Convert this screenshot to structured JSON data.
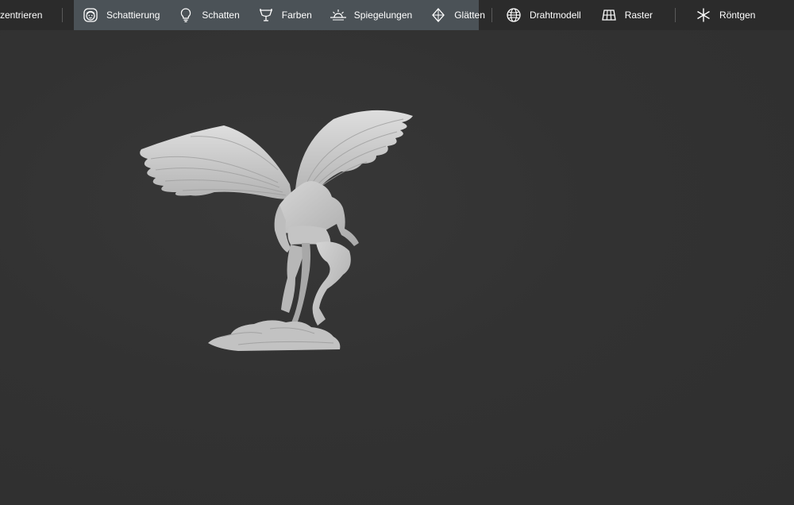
{
  "toolbar": {
    "center_label": "zentrieren",
    "render_group": [
      {
        "id": "shading",
        "label": "Schattierung",
        "icon": "shading-face-icon"
      },
      {
        "id": "shadows",
        "label": "Schatten",
        "icon": "lightbulb-icon"
      },
      {
        "id": "colors",
        "label": "Farben",
        "icon": "paint-bucket-icon"
      },
      {
        "id": "reflections",
        "label": "Spiegelungen",
        "icon": "sunrise-icon"
      },
      {
        "id": "smooth",
        "label": "Glätten",
        "icon": "diamond-icon"
      }
    ],
    "wireframe_label": "Drahtmodell",
    "grid_label": "Raster",
    "xray_label": "Röntgen"
  },
  "colors": {
    "toolbar_bg": "#2b2b2b",
    "group_highlight": "#4b5257",
    "viewport_bg": "#323232",
    "model": "#c9c9c9"
  }
}
